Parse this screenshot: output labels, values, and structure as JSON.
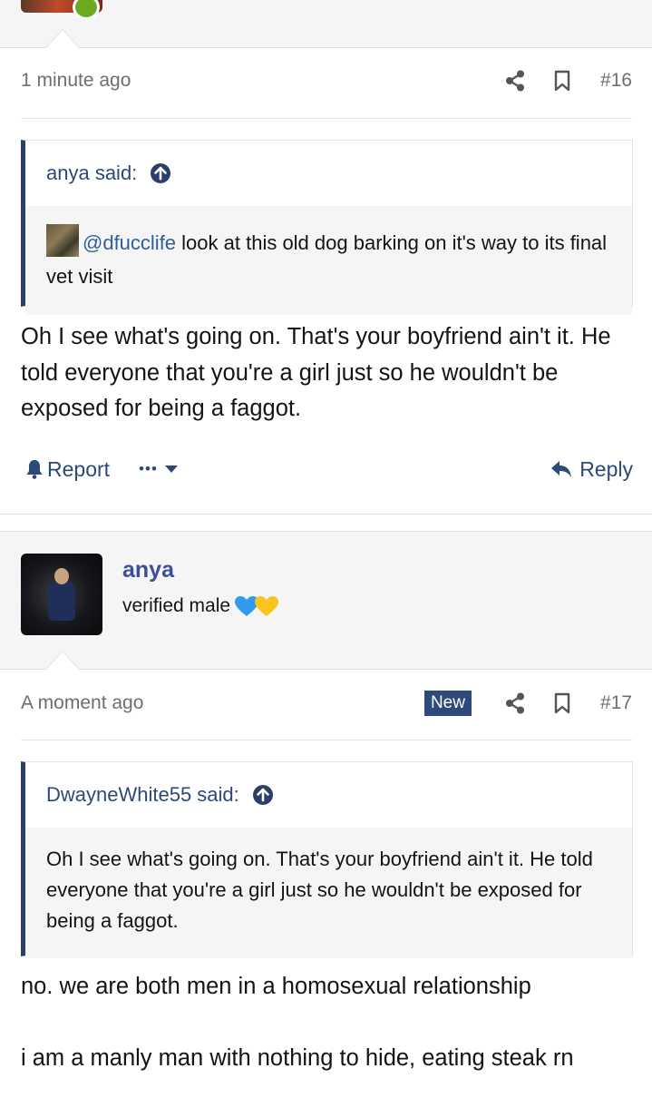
{
  "post16": {
    "time": "1 minute ago",
    "number": "#16",
    "quote": {
      "author": "anya said:",
      "mention": "@dfucclife",
      "text": " look at this old dog barking on it's way to its final vet visit"
    },
    "message": "Oh I see what's going on. That's your boyfriend ain't it. He told everyone that you're a girl just so he wouldn't be exposed for being a faggot.",
    "actions": {
      "report": "Report",
      "more": "•••",
      "reply": "Reply"
    }
  },
  "post17": {
    "user": {
      "name": "anya",
      "title": "verified male"
    },
    "time": "A moment ago",
    "badge": "New",
    "number": "#17",
    "quote": {
      "author": "DwayneWhite55 said:",
      "text": "Oh I see what's going on. That's your boyfriend ain't it. He told everyone that you're a girl just so he wouldn't be exposed for being a faggot."
    },
    "message_lines": [
      "no. we are both men in a homosexual relationship",
      "i am a manly man with nothing to hide, eating steak rn"
    ]
  },
  "colors": {
    "accent": "#2b4a78",
    "username": "#3b4f9c",
    "online": "#6aaa1e",
    "badge": "#2e4a7a"
  },
  "icons": [
    "share-icon",
    "bookmark-icon",
    "arrow-up-circle-icon",
    "bell-icon",
    "caret-down-icon",
    "reply-icon",
    "blue-heart-icon",
    "yellow-heart-icon"
  ]
}
